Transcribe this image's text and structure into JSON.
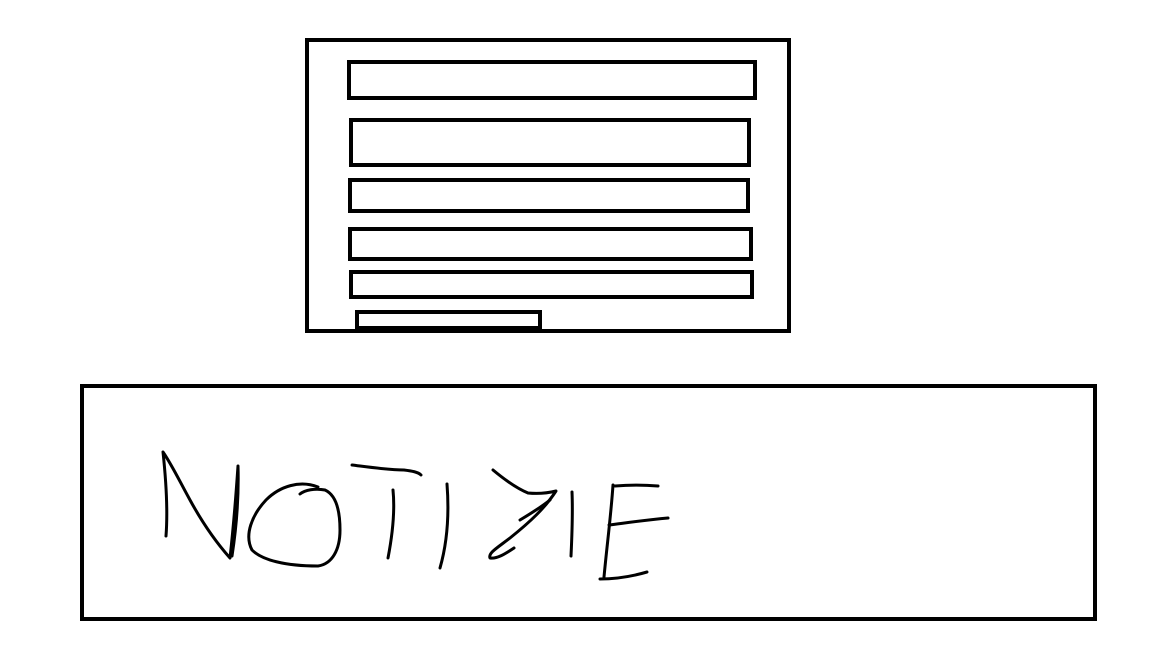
{
  "form": {
    "fields": [
      {
        "id": "field-1"
      },
      {
        "id": "field-2"
      },
      {
        "id": "field-3"
      },
      {
        "id": "field-4"
      },
      {
        "id": "field-5"
      }
    ],
    "button": {
      "id": "submit-bar"
    }
  },
  "notes": {
    "handwritten_label": "NOTIZIE"
  },
  "colors": {
    "stroke": "#000000",
    "background": "#ffffff"
  }
}
